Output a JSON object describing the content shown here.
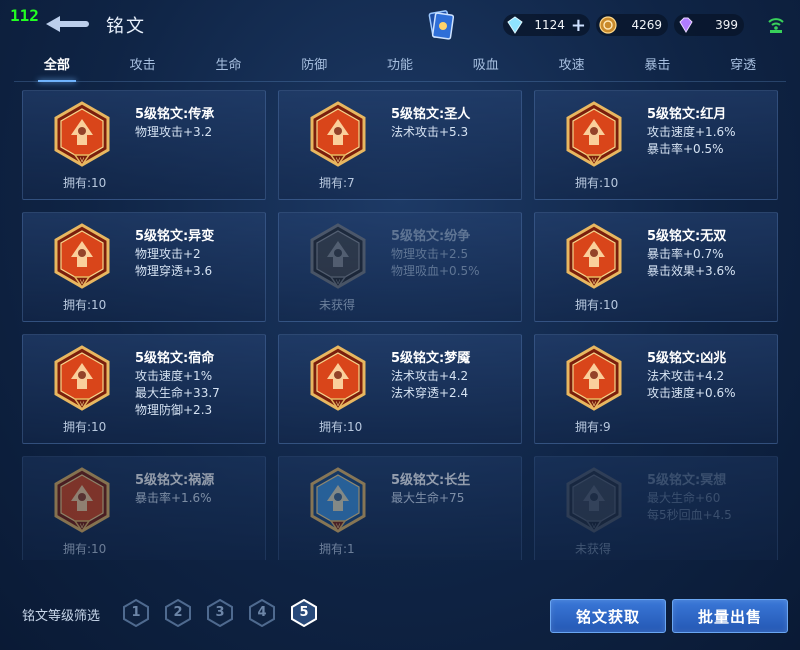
{
  "fps": "112",
  "title": "铭文",
  "resources": [
    {
      "icon": "crystal-icon",
      "value": "1124"
    },
    {
      "icon": "gold-coin-icon",
      "value": "4269"
    },
    {
      "icon": "gem-icon",
      "value": "399"
    }
  ],
  "tabs": [
    "全部",
    "攻击",
    "生命",
    "防御",
    "功能",
    "吸血",
    "攻速",
    "暴击",
    "穿透"
  ],
  "active_tab": 0,
  "inscriptions": [
    {
      "name": "5级铭文:传承",
      "attrs": [
        "物理攻击+3.2"
      ],
      "owned": "拥有:10",
      "color": "#d9451a",
      "locked": false
    },
    {
      "name": "5级铭文:圣人",
      "attrs": [
        "法术攻击+5.3"
      ],
      "owned": "拥有:7",
      "color": "#d9451a",
      "locked": false
    },
    {
      "name": "5级铭文:红月",
      "attrs": [
        "攻击速度+1.6%",
        "暴击率+0.5%"
      ],
      "owned": "拥有:10",
      "color": "#d9451a",
      "locked": false
    },
    {
      "name": "5级铭文:异变",
      "attrs": [
        "物理攻击+2",
        "物理穿透+3.6"
      ],
      "owned": "拥有:10",
      "color": "#d9451a",
      "locked": false
    },
    {
      "name": "5级铭文:纷争",
      "attrs": [
        "物理攻击+2.5",
        "物理吸血+0.5%"
      ],
      "owned": "未获得",
      "color": "#d9451a",
      "locked": true
    },
    {
      "name": "5级铭文:无双",
      "attrs": [
        "暴击率+0.7%",
        "暴击效果+3.6%"
      ],
      "owned": "拥有:10",
      "color": "#d9451a",
      "locked": false
    },
    {
      "name": "5级铭文:宿命",
      "attrs": [
        "攻击速度+1%",
        "最大生命+33.7",
        "物理防御+2.3"
      ],
      "owned": "拥有:10",
      "color": "#d9451a",
      "locked": false
    },
    {
      "name": "5级铭文:梦魇",
      "attrs": [
        "法术攻击+4.2",
        "法术穿透+2.4"
      ],
      "owned": "拥有:10",
      "color": "#d9451a",
      "locked": false
    },
    {
      "name": "5级铭文:凶兆",
      "attrs": [
        "法术攻击+4.2",
        "攻击速度+0.6%"
      ],
      "owned": "拥有:9",
      "color": "#d9451a",
      "locked": false
    },
    {
      "name": "5级铭文:祸源",
      "attrs": [
        "暴击率+1.6%"
      ],
      "owned": "拥有:10",
      "color": "#d9451a",
      "locked": false
    },
    {
      "name": "5级铭文:长生",
      "attrs": [
        "最大生命+75"
      ],
      "owned": "拥有:1",
      "color": "#3a8fd9",
      "locked": false
    },
    {
      "name": "5级铭文:冥想",
      "attrs": [
        "最大生命+60",
        "每5秒回血+4.5"
      ],
      "owned": "未获得",
      "color": "#3a8fd9",
      "locked": true
    }
  ],
  "footer": {
    "filter_label": "铭文等级筛选",
    "levels": [
      "1",
      "2",
      "3",
      "4",
      "5"
    ],
    "active_level": 4,
    "get_button": "铭文获取",
    "sell_button": "批量出售"
  }
}
